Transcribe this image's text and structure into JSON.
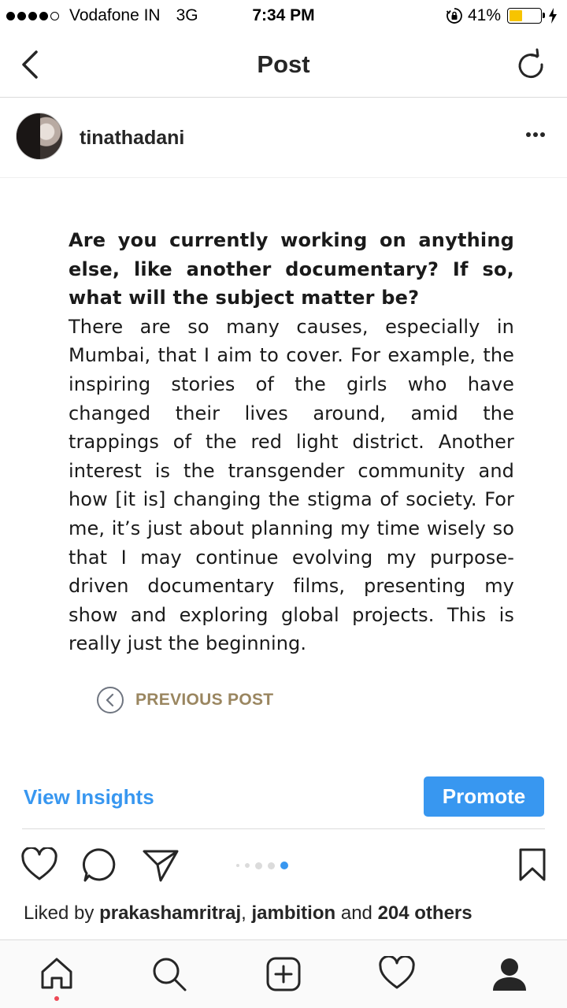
{
  "status_bar": {
    "carrier": "Vodafone IN",
    "network": "3G",
    "time": "7:34 PM",
    "battery": "41%",
    "battery_level": 0.41
  },
  "nav": {
    "title": "Post"
  },
  "post": {
    "username": "tinathadani",
    "article": {
      "question": "Are you currently working on anything else, like another documentary? If so, what will the subject matter be?",
      "answer": "There are so many causes, especially in Mumbai, that I aim to cover. For example, the inspiring stories of the girls who have changed their lives around, amid the trappings of the red light district. Another interest is the transgender community and how [it is] changing the stigma of society. For me, it’s just about planning my time wisely so that I may continue evolving my purpose-driven documentary films, presenting my show and exploring global projects. This is really just the beginning."
    },
    "previous_post_label": "PREVIOUS POST",
    "carousel": {
      "count": 5,
      "active_index": 4
    }
  },
  "insights": {
    "view_insights_label": "View Insights",
    "promote_label": "Promote"
  },
  "likes": {
    "prefix": "Liked by ",
    "user1": "prakashamritraj",
    "separator": ", ",
    "user2": "jambition",
    "middle": " and ",
    "others": "204 others"
  },
  "tab_bar": {
    "items": [
      "home-icon",
      "search-icon",
      "add-icon",
      "heart-icon",
      "profile-icon"
    ],
    "active": "home-icon"
  },
  "colors": {
    "accent": "#3897f0",
    "text": "#262626",
    "previous_post": "#9a8660",
    "notification": "#ed4956",
    "battery": "#f7c400"
  }
}
